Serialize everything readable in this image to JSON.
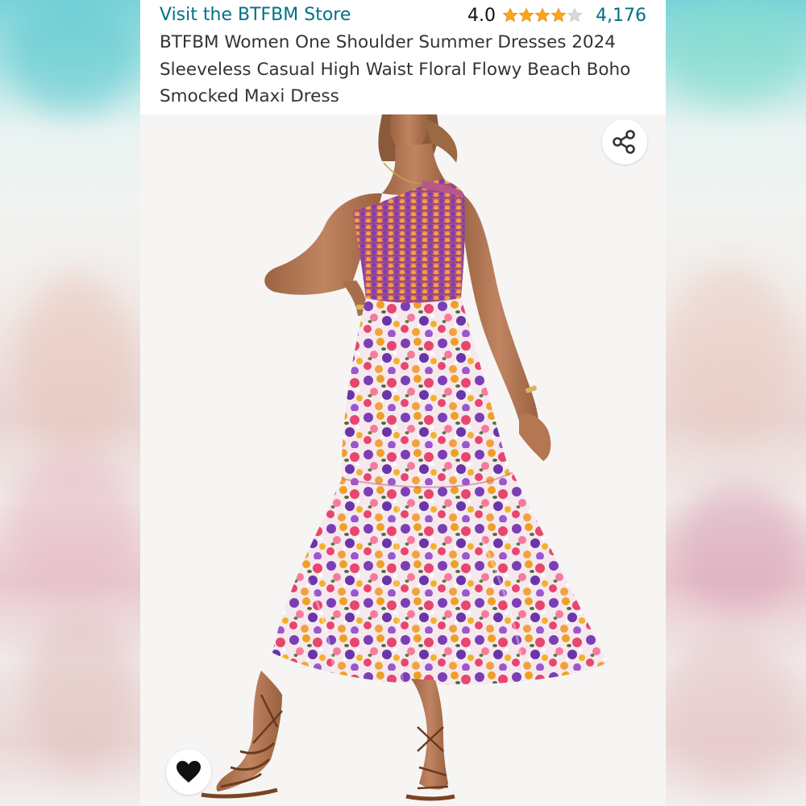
{
  "store": {
    "link_text": "Visit the BTFBM Store",
    "color": "#007185"
  },
  "rating": {
    "value": "4.0",
    "stars_filled": 4,
    "stars_total": 5,
    "review_count": "4,176",
    "star_color": "#FFA41C",
    "star_empty_color": "#D5D9D9"
  },
  "product": {
    "title": "BTFBM Women One Shoulder Summer Dresses 2024 Sleeveless Casual High Waist Floral Flowy Beach Boho Smocked Maxi Dress"
  },
  "icons": {
    "share": "share-icon",
    "wishlist": "heart-icon"
  },
  "image": {
    "description_tag": "product-photo"
  }
}
